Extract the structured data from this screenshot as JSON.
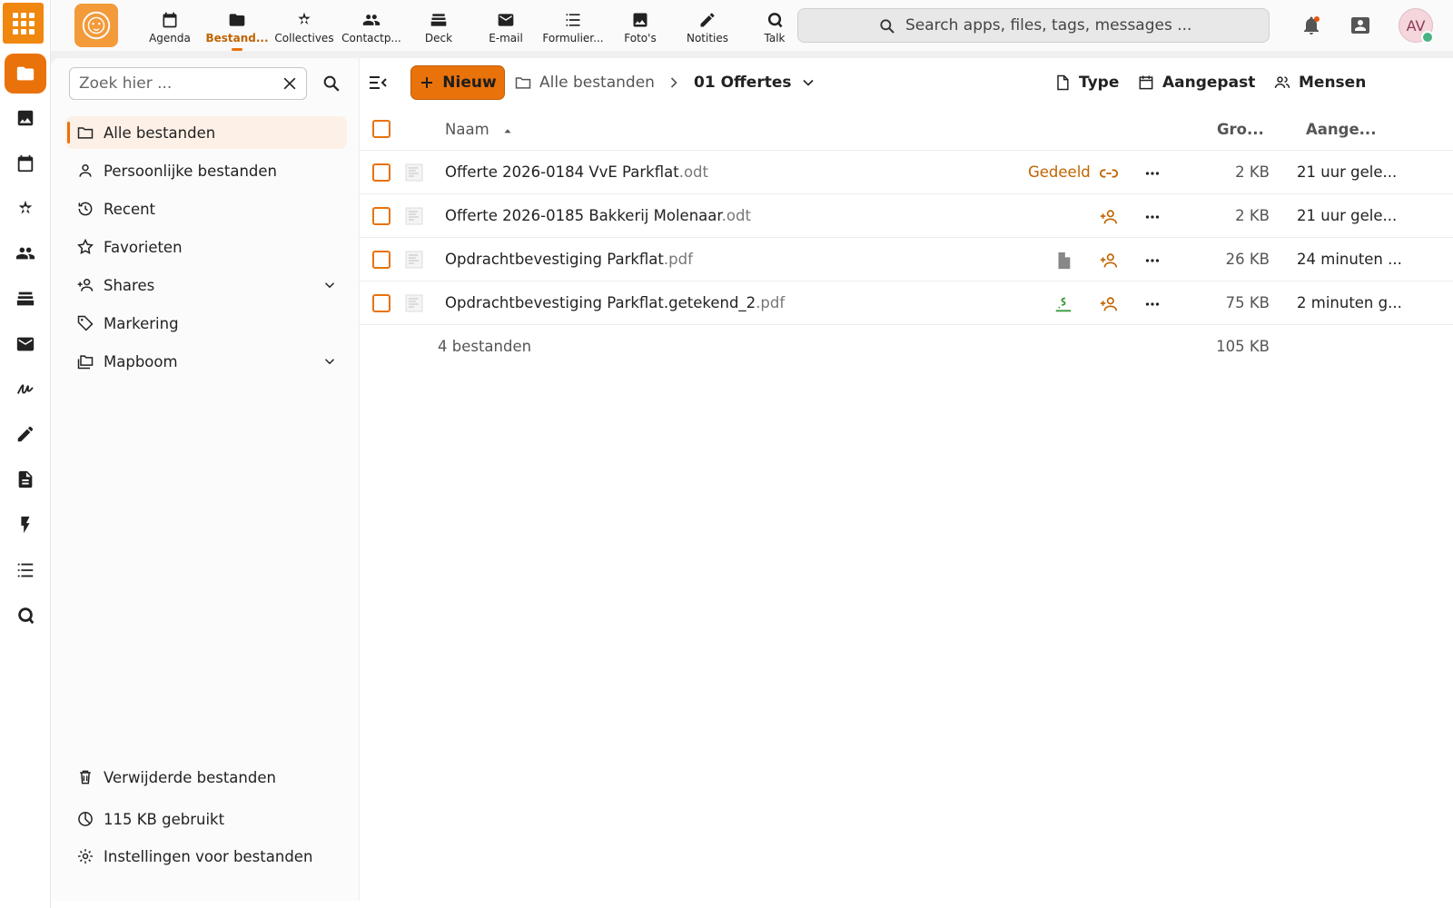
{
  "topbar": {
    "apps": [
      {
        "id": "agenda",
        "label": "Agenda"
      },
      {
        "id": "files",
        "label": "Bestand...",
        "active": true
      },
      {
        "id": "collectives",
        "label": "Collectives"
      },
      {
        "id": "contacts",
        "label": "Contactp..."
      },
      {
        "id": "deck",
        "label": "Deck"
      },
      {
        "id": "mail",
        "label": "E-mail"
      },
      {
        "id": "forms",
        "label": "Formulier..."
      },
      {
        "id": "photos",
        "label": "Foto's"
      },
      {
        "id": "notes",
        "label": "Notities"
      },
      {
        "id": "talk",
        "label": "Talk"
      }
    ],
    "search_placeholder": "Search apps, files, tags, messages ...",
    "avatar_initials": "AV"
  },
  "sidebar": {
    "search_placeholder": "Zoek hier ...",
    "items": [
      {
        "label": "Alle bestanden",
        "icon": "folder-icon",
        "active": true
      },
      {
        "label": "Persoonlijke bestanden",
        "icon": "account-icon"
      },
      {
        "label": "Recent",
        "icon": "history-icon"
      },
      {
        "label": "Favorieten",
        "icon": "star-icon"
      },
      {
        "label": "Shares",
        "icon": "account-plus-icon",
        "expandable": true
      },
      {
        "label": "Markering",
        "icon": "tag-icon"
      },
      {
        "label": "Mapboom",
        "icon": "folder-multiple-icon",
        "expandable": true
      }
    ],
    "trash_label": "Verwijderde bestanden",
    "quota_label": "115 KB gebruikt",
    "settings_label": "Instellingen voor bestanden"
  },
  "toolbar": {
    "new_label": "Nieuw",
    "breadcrumb_root": "Alle bestanden",
    "breadcrumb_current": "01 Offertes",
    "filter_type": "Type",
    "filter_modified": "Aangepast",
    "filter_people": "Mensen"
  },
  "table": {
    "columns": {
      "name": "Naam",
      "size": "Gro...",
      "modified": "Aange..."
    },
    "rows": [
      {
        "base": "Offerte 2026-0184 VvE Parkflat",
        "ext": ".odt",
        "shared_label": "Gedeeld",
        "share_icon": "link-icon",
        "size": "2 KB",
        "modified": "21 uur gele..."
      },
      {
        "base": "Offerte 2026-0185 Bakkerij Molenaar",
        "ext": ".odt",
        "shared_label": "",
        "share_icon": "account-plus-icon",
        "size": "2 KB",
        "modified": "21 uur gele..."
      },
      {
        "base": "Opdrachtbevestiging Parkflat",
        "ext": ".pdf",
        "shared_label": "",
        "share_icon": "account-plus-icon",
        "status_icon": "file-icon",
        "size": "26 KB",
        "modified": "24 minuten ..."
      },
      {
        "base": "Opdrachtbevestiging Parkflat.getekend_2",
        "ext": ".pdf",
        "shared_label": "",
        "share_icon": "account-plus-icon",
        "status_icon": "signature-icon",
        "size": "75 KB",
        "modified": "2 minuten g..."
      }
    ],
    "summary_count": "4 bestanden",
    "summary_size": "105 KB"
  },
  "colors": {
    "accent": "#e9720b",
    "accent_text": "#c06400",
    "signature": "#3a9b3a"
  }
}
